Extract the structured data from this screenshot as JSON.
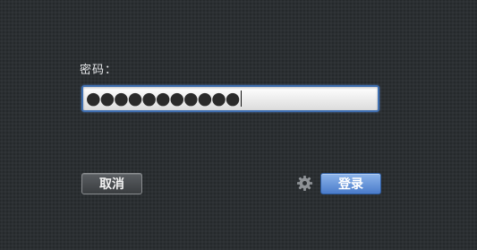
{
  "login": {
    "password_label": "密码：",
    "password_value": "●●●●●●●●●●●",
    "cancel_label": "取消",
    "login_label": "登录"
  },
  "icons": {
    "settings": "gear-icon"
  },
  "colors": {
    "background": "#2b2f32",
    "field_focus": "#3f6fb0",
    "login_button": "#4a7ccb"
  }
}
